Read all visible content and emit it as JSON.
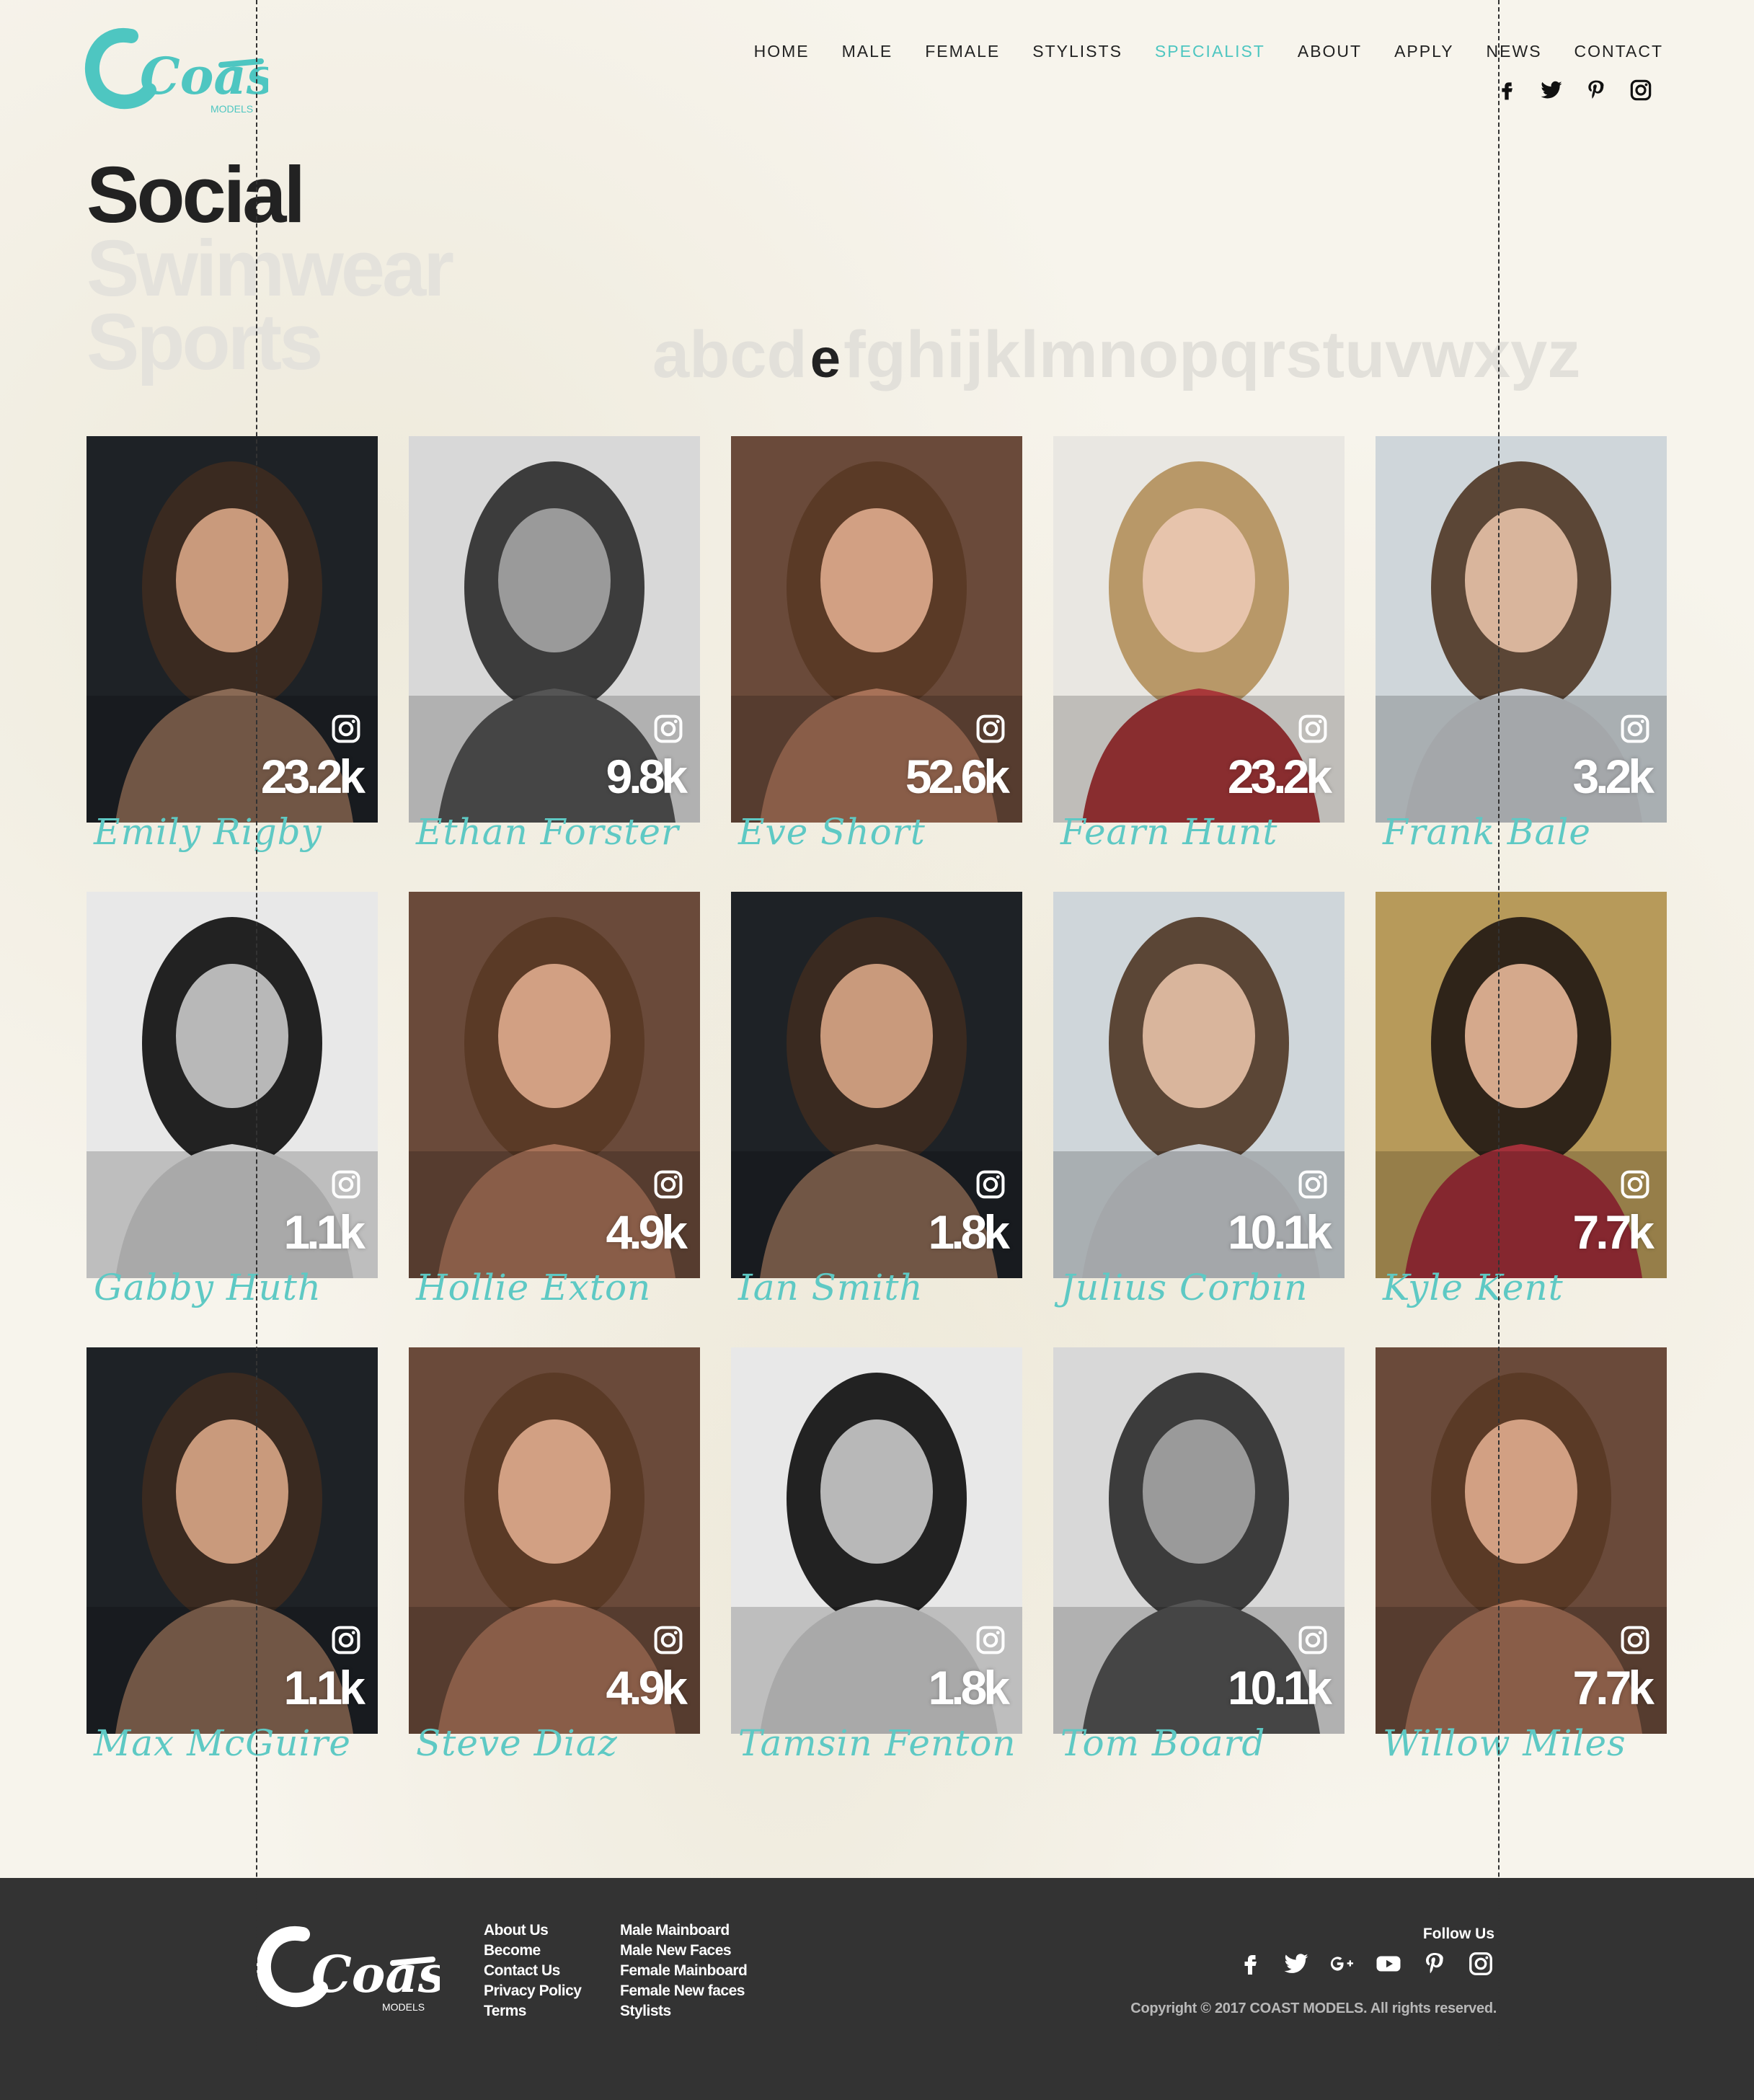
{
  "brand": {
    "logo_text": "Coast",
    "logo_sub": "MODELS",
    "accent": "#4ec6c1"
  },
  "nav": {
    "items": [
      {
        "label": "HOME",
        "active": false
      },
      {
        "label": "MALE",
        "active": false
      },
      {
        "label": "FEMALE",
        "active": false
      },
      {
        "label": "STYLISTS",
        "active": false
      },
      {
        "label": "SPECIALIST",
        "active": true
      },
      {
        "label": "ABOUT",
        "active": false
      },
      {
        "label": "APPLY",
        "active": false
      },
      {
        "label": "NEWS",
        "active": false
      },
      {
        "label": "CONTACT",
        "active": false
      }
    ],
    "social_icons": [
      "facebook-icon",
      "twitter-icon",
      "pinterest-icon",
      "instagram-icon"
    ]
  },
  "categories": [
    "Social",
    "Swimwear",
    "Sports"
  ],
  "alphabet": {
    "before": "abcd",
    "current": "e",
    "after": "fghijklmnopqrstuvwxyz"
  },
  "models": [
    {
      "name": "Emily Rigby",
      "followers": "23.2k",
      "tone": "color-dark"
    },
    {
      "name": "Ethan Forster",
      "followers": "9.8k",
      "tone": "bw"
    },
    {
      "name": "Eve Short",
      "followers": "52.6k",
      "tone": "color-warm"
    },
    {
      "name": "Fearn Hunt",
      "followers": "23.2k",
      "tone": "color-light"
    },
    {
      "name": "Frank Bale",
      "followers": "3.2k",
      "tone": "color-pale"
    },
    {
      "name": "Gabby Huth",
      "followers": "1.1k",
      "tone": "bw-light"
    },
    {
      "name": "Hollie Exton",
      "followers": "4.9k",
      "tone": "color-warm"
    },
    {
      "name": "Ian Smith",
      "followers": "1.8k",
      "tone": "color-dark"
    },
    {
      "name": "Julius Corbin",
      "followers": "10.1k",
      "tone": "color-pale"
    },
    {
      "name": "Kyle Kent",
      "followers": "7.7k",
      "tone": "color-field"
    },
    {
      "name": "Max McGuire",
      "followers": "1.1k",
      "tone": "color-dark"
    },
    {
      "name": "Steve Diaz",
      "followers": "4.9k",
      "tone": "color-warm"
    },
    {
      "name": "Tamsin Fenton",
      "followers": "1.8k",
      "tone": "bw-light"
    },
    {
      "name": "Tom Board",
      "followers": "10.1k",
      "tone": "bw"
    },
    {
      "name": "Willow Miles",
      "followers": "7.7k",
      "tone": "color-warm"
    }
  ],
  "footer": {
    "col_a": [
      "About Us",
      "Become",
      "Contact Us",
      "Privacy Policy",
      "Terms"
    ],
    "col_b": [
      "Male Mainboard",
      "Male New Faces",
      "Female Mainboard",
      "Female New faces",
      "Stylists"
    ],
    "follow_label": "Follow Us",
    "social_icons": [
      "facebook-icon",
      "twitter-icon",
      "google-plus-icon",
      "youtube-icon",
      "pinterest-icon",
      "instagram-icon"
    ],
    "copyright": "Copyright © 2017 COAST MODELS. All rights reserved."
  }
}
